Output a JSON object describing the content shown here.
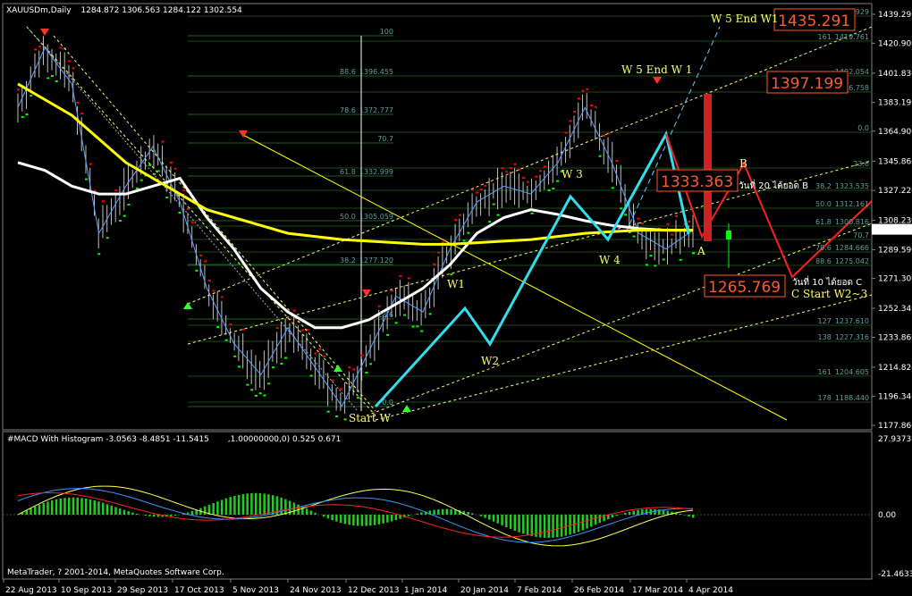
{
  "window": {
    "symbol_header": "XAUUSDm,Daily",
    "ohlc": "1284.872 1306.563 1284.122 1302.554",
    "copyright": "MetaTrader, ? 2001-2014, MetaQuotes Software Corp."
  },
  "macd": {
    "header": "#MACD With Histogram -3.0563 -8.4851 -11.5415",
    "header_extra": ",1.00000000,0) 0.525 0.671",
    "y_labels": [
      "27.9373",
      "0.00",
      "-21.4633"
    ]
  },
  "colors": {
    "background": "#000000",
    "grid": "#1f5f1f",
    "price_up": "#00ff00",
    "price_down": "#ff0000",
    "ma_yellow": "#ffff00",
    "ma_white": "#ffffff",
    "cyan_wave": "#33ddee",
    "projection_red": "#ff2020",
    "box_orange": "#ff5a2a"
  },
  "chart_data": {
    "type": "line",
    "title": "XAUUSDm,Daily",
    "price_axis": [
      "1439.290",
      "1420.900",
      "1401.830",
      "1383.190",
      "1364.900",
      "1345.860",
      "1327.220",
      "1308.230",
      "1289.590",
      "1271.300",
      "1252.340",
      "1233.860",
      "1214.820",
      "1196.340",
      "1177.860"
    ],
    "current_price": "1302.554",
    "date_axis": [
      "22 Aug 2013",
      "10 Sep 2013",
      "29 Sep 2013",
      "17 Oct 2013",
      "5 Nov 2013",
      "24 Nov 2013",
      "12 Dec 2013",
      "1 Jan 2014",
      "20 Jan 2014",
      "7 Feb 2014",
      "26 Feb 2014",
      "17 Mar 2014",
      "4 Apr 2014"
    ],
    "fib_left": [
      {
        "pct": "100",
        "price": ""
      },
      {
        "pct": "88.6",
        "price": "1396.455"
      },
      {
        "pct": "78.6",
        "price": "1372.777"
      },
      {
        "pct": "70.7",
        "price": ""
      },
      {
        "pct": "61.8",
        "price": "1332.999"
      },
      {
        "pct": "50.0",
        "price": "1305.059"
      },
      {
        "pct": "38.2",
        "price": "1277.120"
      },
      {
        "pct": "23.6",
        "price": ""
      },
      {
        "pct": "0.0",
        "price": ""
      }
    ],
    "fib_right": [
      {
        "pct": "",
        "price": "1439.929"
      },
      {
        "pct": "161",
        "price": "1419.761"
      },
      {
        "pct": "",
        "price": "1402.054"
      },
      {
        "pct": "127",
        "price": "1386.758"
      },
      {
        "pct": "0.0",
        "price": ""
      },
      {
        "pct": "23.6",
        "price": ""
      },
      {
        "pct": "38.2",
        "price": "1323.535"
      },
      {
        "pct": "50.0",
        "price": "1312.161"
      },
      {
        "pct": "61.8",
        "price": "1300.816"
      },
      {
        "pct": "70.7",
        "price": ""
      },
      {
        "pct": "78.6",
        "price": "1284.666"
      },
      {
        "pct": "88.6",
        "price": "1275.042"
      },
      {
        "pct": "127",
        "price": "1237.610"
      },
      {
        "pct": "138",
        "price": "1227.316"
      },
      {
        "pct": "161",
        "price": "1204.605"
      },
      {
        "pct": "178",
        "price": "1188.440"
      }
    ],
    "wave_labels": [
      "Start W",
      "W1",
      "W2",
      "W 3",
      "W 4",
      "W 5  End W 1",
      "W 5   End W1",
      "A",
      "B",
      "C  Start W2~3"
    ],
    "target_boxes": [
      "1435.291",
      "1397.199",
      "1333.363",
      "1265.769"
    ],
    "thai_notes": [
      "วันที่ 20 ได้ยอด B",
      "วันที่ 10 ได้ยอด C"
    ],
    "series": [
      {
        "values": [
          1380,
          1418,
          1395,
          1300,
          1330,
          1355,
          1320,
          1265,
          1230,
          1210,
          1240,
          1215,
          1190,
          1225,
          1260,
          1250,
          1290,
          1320,
          1330,
          1325,
          1345,
          1380,
          1345,
          1300,
          1290,
          1302
        ]
      },
      {
        "values": [
          1345,
          1340,
          1330,
          1325,
          1325,
          1330,
          1335,
          1310,
          1290,
          1265,
          1250,
          1240,
          1240,
          1245,
          1255,
          1265,
          1280,
          1300,
          1310,
          1315,
          1312,
          1308,
          1305,
          1303,
          1302,
          1302
        ]
      },
      {
        "values": [
          1395,
          1385,
          1375,
          1360,
          1345,
          1335,
          1325,
          1315,
          1310,
          1305,
          1300,
          1298,
          1296,
          1295,
          1294,
          1293,
          1293,
          1294,
          1295,
          1296,
          1298,
          1300,
          1301,
          1302,
          1302,
          1302
        ]
      }
    ]
  }
}
